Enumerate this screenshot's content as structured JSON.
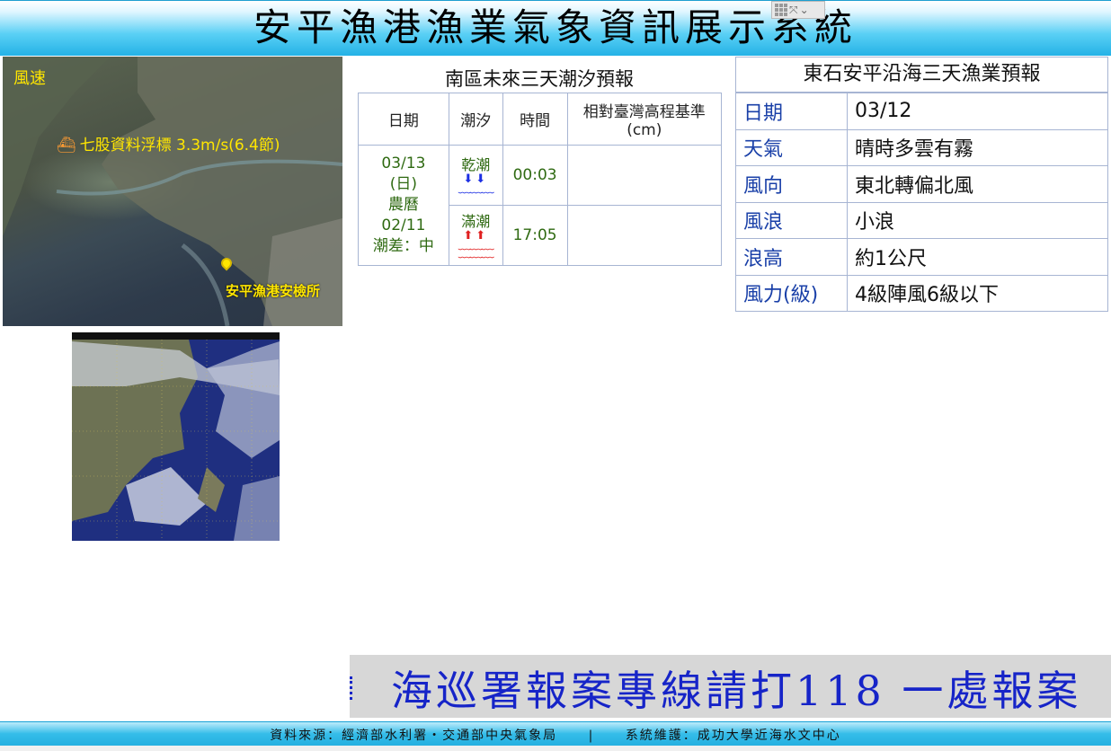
{
  "header": {
    "title": "安平漁港漁業氣象資訊展示系統"
  },
  "map": {
    "wind_label": "風速",
    "buoy": {
      "name": "七股資料浮標",
      "reading": "3.3m/s(6.4節)",
      "icon": "buoy-icon"
    },
    "station": "安平漁港安檢所",
    "pin_icon": "location-pin-icon"
  },
  "tide": {
    "title": "南區未來三天潮汐預報",
    "headers": [
      "日期",
      "潮汐",
      "時間",
      "相對臺灣高程基準(cm)"
    ],
    "date": {
      "solar": "03/13",
      "weekday": "(日)",
      "lunar_label": "農曆",
      "lunar": "02/11",
      "range": "潮差：中"
    },
    "rows": [
      {
        "type": "乾潮",
        "time": "00:03",
        "level": "",
        "icon": "low-tide-icon",
        "color": "#1c2fe3"
      },
      {
        "type": "滿潮",
        "time": "17:05",
        "level": "",
        "icon": "high-tide-icon",
        "color": "#e01f1f"
      }
    ]
  },
  "fishery": {
    "title": "東石安平沿海三天漁業預報",
    "rows": [
      {
        "key": "日期",
        "value": "03/12"
      },
      {
        "key": "天氣",
        "value": "晴時多雲有霧"
      },
      {
        "key": "風向",
        "value": "東北轉偏北風"
      },
      {
        "key": "風浪",
        "value": "小浪"
      },
      {
        "key": "浪高",
        "value": "約1公尺"
      },
      {
        "key": "風力(級)",
        "value": "4級陣風6級以下"
      }
    ]
  },
  "marquee": {
    "text": "海巡署報案專線請打118 一處報案"
  },
  "footer": {
    "source": "資料來源：經濟部水利署‧交通部中央氣象局",
    "separator": "|",
    "maintainer": "系統維護：成功大學近海水文中心"
  },
  "colors": {
    "header": "#24b2e6",
    "key_text": "#1a40a8",
    "marquee_text": "#1624c8",
    "tide_green": "#2f6a12"
  }
}
